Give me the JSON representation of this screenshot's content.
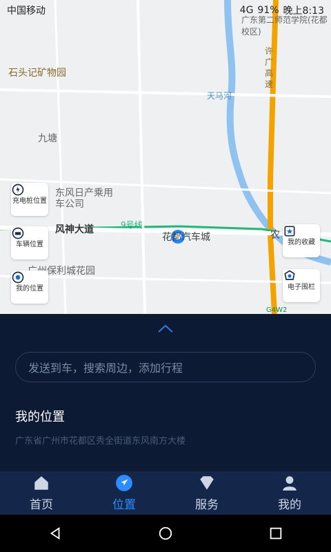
{
  "status": {
    "carrier": "中国移动",
    "battery": "91%",
    "time": "晚上8:13",
    "signal": "4G"
  },
  "map": {
    "labels": {
      "school": "广东第二师范学院(花都校区)",
      "park": "石头记矿物园",
      "river": "天马河",
      "jiutang": "九塘",
      "dongfeng": "东风日产乘用车公司",
      "road": "风神大道",
      "line": "9号线",
      "carcity": "花都汽车城",
      "garden": "广州保利城花园",
      "highway": "许广高速",
      "g4w2": "G4W2",
      "nong": "农"
    },
    "buttons": {
      "charging": "充电桩位置",
      "vehicle": "车辆位置",
      "mine": "我的位置",
      "favorites": "我的收藏",
      "geofence": "电子围栏"
    }
  },
  "panel": {
    "search_placeholder": "发送到车，搜索周边，添加行程",
    "my_location_title": "我的位置",
    "address": "广东省广州市花都区秀全街道东风南方大楼"
  },
  "tabs": [
    {
      "label": "首页",
      "icon": "home-icon",
      "active": false
    },
    {
      "label": "位置",
      "icon": "navigation-icon",
      "active": true
    },
    {
      "label": "服务",
      "icon": "service-icon",
      "active": false
    },
    {
      "label": "我的",
      "icon": "user-icon",
      "active": false
    }
  ],
  "colors": {
    "accent": "#2e8cff",
    "panel_bg": "#0c1a33",
    "tab_bg": "#14264a"
  }
}
